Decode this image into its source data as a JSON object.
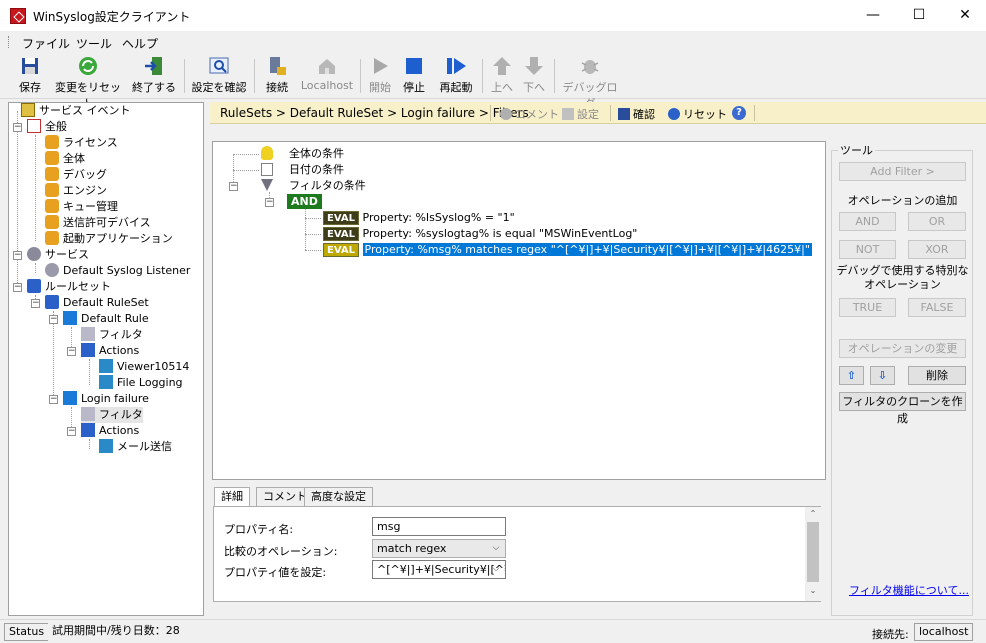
{
  "window": {
    "title": "WinSyslog設定クライアント",
    "minimize": "—",
    "maximize": "☐",
    "close": "✕"
  },
  "menu": [
    "ファイル",
    "ツール",
    "ヘルプ"
  ],
  "toolbar": {
    "save": "保存",
    "reset_changes": "変更をリセット",
    "exit": "終了する",
    "confirm_settings": "設定を確認",
    "connect": "接続",
    "localhost": "Localhost",
    "start": "開始",
    "stop": "停止",
    "restart": "再起動",
    "up": "上へ",
    "down": "下へ",
    "debug_log": "デバッグログ"
  },
  "breadcrumb": {
    "path": "RuleSets > Default RuleSet > Login failure > Filters",
    "comment": "コメント",
    "settings": "設定",
    "confirm": "確認",
    "reset": "リセット"
  },
  "tree": {
    "service_event": "サービス イベント",
    "general": "全般",
    "license": "ライセンス",
    "overall": "全体",
    "debug": "デバッグ",
    "engine": "エンジン",
    "queue": "キュー管理",
    "allowed_devices": "送信許可デバイス",
    "startup_apps": "起動アプリケーション",
    "services": "サービス",
    "default_listener": "Default Syslog Listener",
    "rulesets": "ルールセット",
    "default_ruleset": "Default RuleSet",
    "default_rule": "Default Rule",
    "filter1": "フィルタ",
    "actions1": "Actions",
    "viewer": "Viewer10514",
    "file_logging": "File Logging",
    "login_failure": "Login failure",
    "filter2": "フィルタ",
    "actions2": "Actions",
    "mail_send": "メール送信"
  },
  "filters": {
    "global": "全体の条件",
    "date": "日付の条件",
    "filter_cond": "フィルタの条件",
    "and": "AND",
    "eval": "EVAL",
    "rows": [
      "Property: %IsSyslog% = \"1\"",
      "Property: %syslogtag% is equal \"MSWinEventLog\"",
      "Property: %msg% matches regex \"^[^¥|]+¥|Security¥|[^¥|]+¥|[^¥|]+¥|4625¥|\""
    ]
  },
  "tabs": [
    "詳細",
    "コメント",
    "高度な設定"
  ],
  "details": {
    "property_name_label": "プロパティ名:",
    "property_name_value": "msg",
    "compare_op_label": "比較のオペレーション:",
    "compare_op_value": "match regex",
    "property_value_label": "プロパティ値を設定:",
    "property_value_value": "^[^¥|]+¥|Security¥|[^¥|"
  },
  "tools": {
    "title": "ツール",
    "add_filter": "Add Filter >",
    "add_operation": "オペレーションの追加",
    "and": "AND",
    "or": "OR",
    "not": "NOT",
    "xor": "XOR",
    "debug_ops": "デバッグで使用する特別なオペレーション",
    "true": "TRUE",
    "false": "FALSE",
    "change_op": "オペレーションの変更",
    "up_arrow": "⇧",
    "down_arrow": "⇩",
    "delete": "削除",
    "clone": "フィルタのクローンを作成",
    "help_link": "フィルタ機能について..."
  },
  "status": {
    "status": "Status",
    "trial": "試用期間中/残り日数：28",
    "connect_label": "接続先:",
    "connect_value": "localhost"
  }
}
